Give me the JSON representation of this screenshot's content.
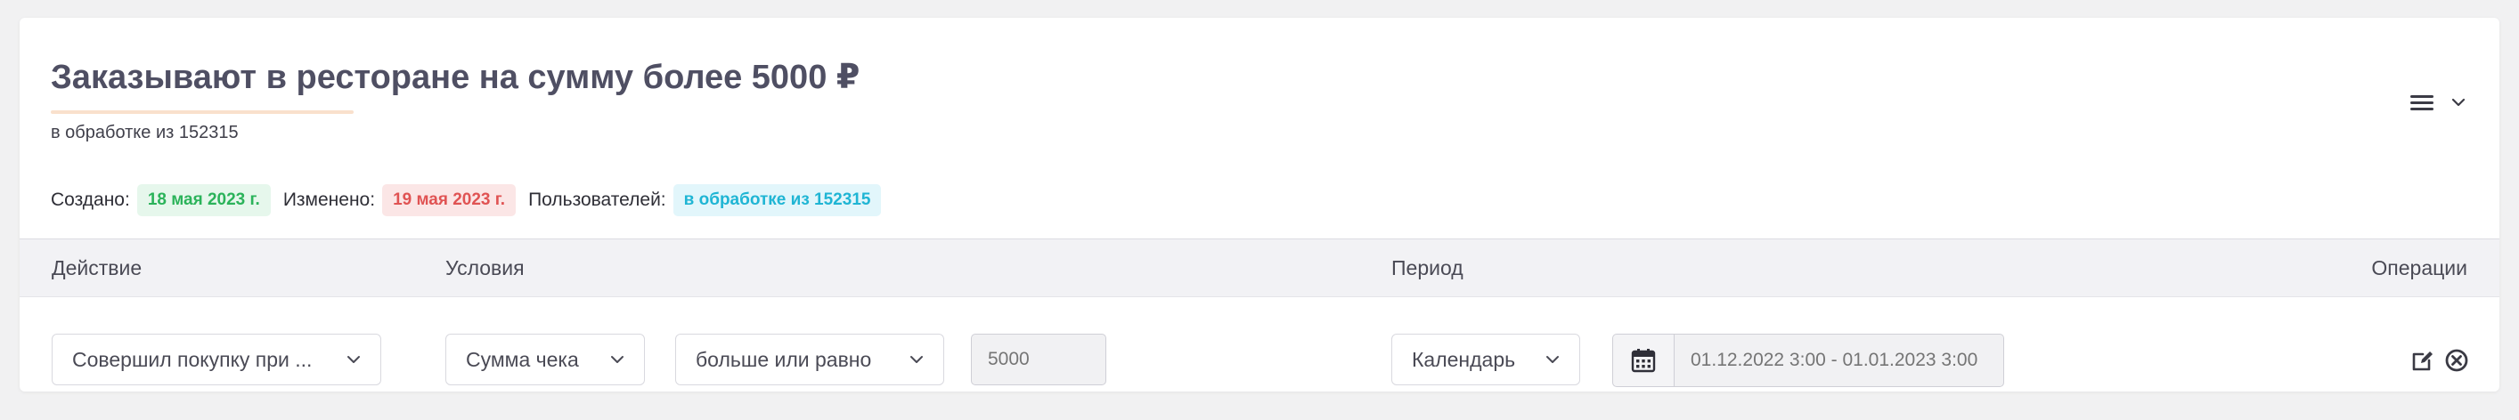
{
  "header": {
    "title": "Заказывают в ресторане на сумму более 5000 ₽",
    "subtitle": "в обработке из 152315",
    "created_label": "Создано:",
    "created_value": "18 мая 2023 г.",
    "modified_label": "Изменено:",
    "modified_value": "19 мая 2023 г.",
    "users_label": "Пользователей:",
    "users_value": "в обработке из 152315"
  },
  "table": {
    "columns": [
      "Действие",
      "Условия",
      "Период",
      "Операции"
    ],
    "row": {
      "action": "Совершил покупку при ...",
      "condition_field": "Сумма чека",
      "condition_operator": "больше или равно",
      "condition_value_placeholder": "5000",
      "period_type": "Календарь",
      "date_range_placeholder": "01.12.2022 3:00 - 01.01.2023 3:00"
    }
  },
  "icons": {
    "menu": "hamburger-icon",
    "menu_chevron": "chevron-down-icon",
    "calendar": "calendar-icon",
    "edit": "edit-icon",
    "delete": "close-circle-icon"
  },
  "colors": {
    "green_badge": "#2bb35a",
    "red_badge": "#e05353",
    "cyan_badge": "#1fb5d4",
    "title": "#4f4f63"
  }
}
